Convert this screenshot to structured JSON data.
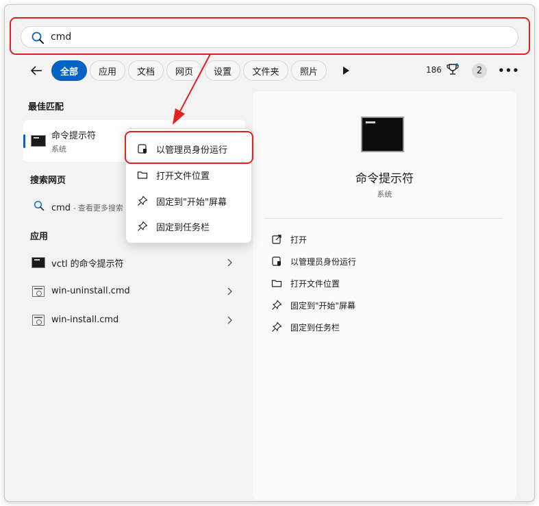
{
  "search": {
    "query": "cmd"
  },
  "filters": {
    "chips": [
      "全部",
      "应用",
      "文档",
      "网页",
      "设置",
      "文件夹",
      "照片"
    ],
    "active_index": 0,
    "count": "186",
    "badge": "2"
  },
  "left": {
    "best_match_header": "最佳匹配",
    "best_match": {
      "title": "命令提示符",
      "subtitle": "系统"
    },
    "web_header": "搜索网页",
    "web_item": {
      "query": "cmd",
      "suffix": " - 查看更多搜索"
    },
    "apps_header": "应用",
    "apps": [
      {
        "title": "vctl 的命令提示符",
        "icon": "cmd-icon"
      },
      {
        "title": "win-uninstall.cmd",
        "icon": "script-icon"
      },
      {
        "title": "win-install.cmd",
        "icon": "script-icon"
      }
    ]
  },
  "context_menu": {
    "items": [
      {
        "label": "以管理员身份运行",
        "icon": "shield-icon"
      },
      {
        "label": "打开文件位置",
        "icon": "folder-icon"
      },
      {
        "label": "固定到\"开始\"屏幕",
        "icon": "pin-icon"
      },
      {
        "label": "固定到任务栏",
        "icon": "pin-icon"
      }
    ]
  },
  "right": {
    "title": "命令提示符",
    "subtitle": "系统",
    "actions": [
      {
        "label": "打开",
        "icon": "open-external-icon"
      },
      {
        "label": "以管理员身份运行",
        "icon": "shield-icon"
      },
      {
        "label": "打开文件位置",
        "icon": "folder-icon"
      },
      {
        "label": "固定到\"开始\"屏幕",
        "icon": "pin-icon"
      },
      {
        "label": "固定到任务栏",
        "icon": "pin-icon"
      }
    ]
  },
  "colors": {
    "accent": "#0563c1",
    "highlight": "#e1201f"
  }
}
